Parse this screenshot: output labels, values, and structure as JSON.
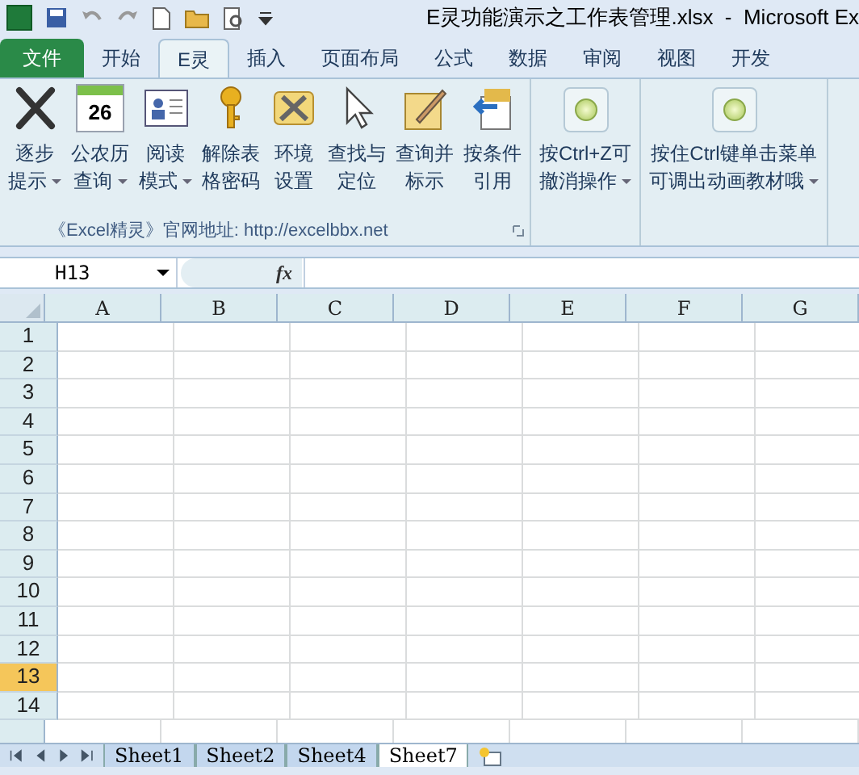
{
  "window": {
    "title": "E灵功能演示之工作表管理.xlsx  -  Microsoft Ex"
  },
  "ribbon_tabs": [
    {
      "label": "文件",
      "kind": "file",
      "selected": false
    },
    {
      "label": "开始",
      "kind": "tab",
      "selected": false
    },
    {
      "label": "E灵",
      "kind": "tab",
      "selected": true
    },
    {
      "label": "插入",
      "kind": "tab",
      "selected": false
    },
    {
      "label": "页面布局",
      "kind": "tab",
      "selected": false
    },
    {
      "label": "公式",
      "kind": "tab",
      "selected": false
    },
    {
      "label": "数据",
      "kind": "tab",
      "selected": false
    },
    {
      "label": "审阅",
      "kind": "tab",
      "selected": false
    },
    {
      "label": "视图",
      "kind": "tab",
      "selected": false
    },
    {
      "label": "开发",
      "kind": "tab",
      "selected": false
    }
  ],
  "ribbon_groups": [
    {
      "caption": "《Excel精灵》官网地址: http://excelbbx.net",
      "buttons": [
        {
          "kind": "cross",
          "lines": [
            "逐步",
            "提示"
          ],
          "dropdown": true
        },
        {
          "kind": "calendar",
          "badge": "26",
          "lines": [
            "公农历",
            "查询"
          ],
          "dropdown": true
        },
        {
          "kind": "card",
          "lines": [
            "阅读",
            "模式"
          ],
          "dropdown": true
        },
        {
          "kind": "key",
          "lines": [
            "解除表",
            "格密码"
          ],
          "dropdown": false
        },
        {
          "kind": "tools",
          "lines": [
            "环境",
            "设置"
          ],
          "dropdown": false
        },
        {
          "kind": "cursor",
          "lines": [
            "查找与",
            "定位"
          ],
          "dropdown": false
        },
        {
          "kind": "pencil",
          "lines": [
            "查询并",
            "标示"
          ],
          "dropdown": false
        },
        {
          "kind": "reference",
          "lines": [
            "按条件",
            "引用"
          ],
          "dropdown": false
        }
      ]
    },
    {
      "buttons": [
        {
          "kind": "orb",
          "lines": [
            "按Ctrl+Z可",
            "撤消操作"
          ],
          "dropdown": true
        }
      ]
    },
    {
      "buttons": [
        {
          "kind": "orb",
          "lines": [
            "按住Ctrl键单击菜单",
            "可调出动画教材哦"
          ],
          "dropdown": true
        }
      ]
    }
  ],
  "name_box": {
    "value": "H13"
  },
  "formula_bar": {
    "fx": "fx"
  },
  "columns": [
    "A",
    "B",
    "C",
    "D",
    "E",
    "F",
    "G"
  ],
  "rows": [
    {
      "label": "1",
      "selected": false
    },
    {
      "label": "2",
      "selected": false
    },
    {
      "label": "3",
      "selected": false
    },
    {
      "label": "4",
      "selected": false
    },
    {
      "label": "5",
      "selected": false
    },
    {
      "label": "6",
      "selected": false
    },
    {
      "label": "7",
      "selected": false
    },
    {
      "label": "8",
      "selected": false
    },
    {
      "label": "9",
      "selected": false
    },
    {
      "label": "10",
      "selected": false
    },
    {
      "label": "11",
      "selected": false
    },
    {
      "label": "12",
      "selected": false
    },
    {
      "label": "13",
      "selected": true
    },
    {
      "label": "14",
      "selected": false
    }
  ],
  "sheet_tabs": [
    {
      "label": "Sheet1",
      "selected": false
    },
    {
      "label": "Sheet2",
      "selected": false
    },
    {
      "label": "Sheet4",
      "selected": false
    },
    {
      "label": "Sheet7",
      "selected": true
    }
  ]
}
